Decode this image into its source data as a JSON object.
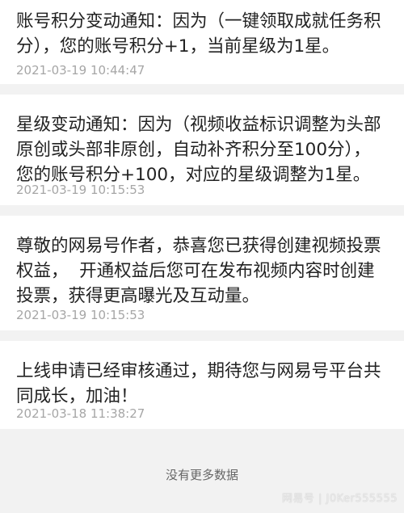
{
  "notifications": [
    {
      "message": "账号积分变动通知：因为（一键领取成就任务积分），您的账号积分+1，当前星级为1星。",
      "time": "2021-03-19 10:44:47"
    },
    {
      "message": "星级变动通知：因为（视频收益标识调整为头部原创或头部非原创，自动补齐积分至100分），您的账号积分+100，对应的星级调整为1星。",
      "time": "2021-03-19 10:15:53"
    },
    {
      "message": "尊敬的网易号作者，恭喜您已获得创建视频投票权益，  开通权益后您可在发布视频内容时创建投票，获得更高曝光及互动量。",
      "time": "2021-03-19 10:15:53"
    },
    {
      "message": "上线申请已经审核通过，期待您与网易号平台共同成长，加油！",
      "time": "2021-03-18 11:38:27"
    }
  ],
  "footer": {
    "no_more": "没有更多数据"
  },
  "watermark": {
    "text": "网易号 | J0Ker555555"
  },
  "colors": {
    "background": "#f2f2f2",
    "card": "#ffffff",
    "text": "#222222",
    "timestamp": "#a6a6a6"
  }
}
